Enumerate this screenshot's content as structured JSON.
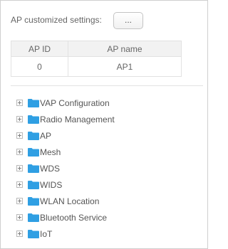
{
  "colors": {
    "folder": "#2f9fe3",
    "border": "#cfcfcf",
    "header_bg": "#f2f2f2"
  },
  "ap_settings": {
    "label": "AP customized settings:",
    "button_label": "..."
  },
  "ap_table": {
    "columns": [
      "AP ID",
      "AP name"
    ],
    "rows": [
      [
        "0",
        "AP1"
      ]
    ]
  },
  "tree": {
    "items": [
      {
        "label": "VAP Configuration",
        "icon": "folder-icon"
      },
      {
        "label": "Radio Management",
        "icon": "folder-icon"
      },
      {
        "label": "AP",
        "icon": "folder-icon"
      },
      {
        "label": "Mesh",
        "icon": "folder-icon"
      },
      {
        "label": "WDS",
        "icon": "folder-icon"
      },
      {
        "label": "WIDS",
        "icon": "folder-icon"
      },
      {
        "label": "WLAN Location",
        "icon": "folder-icon"
      },
      {
        "label": "Bluetooth Service",
        "icon": "folder-icon"
      },
      {
        "label": "IoT",
        "icon": "folder-icon"
      }
    ]
  }
}
